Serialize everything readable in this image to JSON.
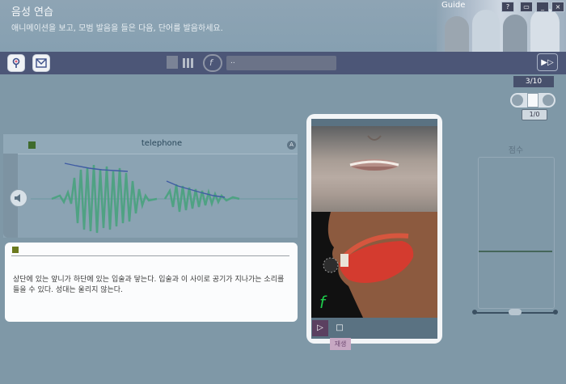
{
  "header": {
    "title": "음성 연습",
    "subtitle": "애니메이션을 보고, 모범 발음을 들은 다음, 단어를 발음하세요.",
    "guide_label": "Guide"
  },
  "toolbar": {
    "progress_time": "..",
    "play_icon": "play-next-icon"
  },
  "page_counter": "3/10",
  "speed_value": "1/0",
  "wave": {
    "word": "telephone",
    "play_badge": "A"
  },
  "description": "상단에 있는 앞니가 하단에 있는 입술과 닿는다. 입술과 이 사이로 공기가 지나가는 소리를 들을 수 있다. 성대는 울리지 않는다.",
  "viewer": {
    "phoneme": "f",
    "replay_label": "재생"
  },
  "score": {
    "label": "점수"
  },
  "colors": {
    "toolbar": "#4c5677",
    "wave_green": "#44a27a",
    "pitch_blue": "#3f5ca3",
    "viewer_phoneme": "#1ecb4c"
  }
}
